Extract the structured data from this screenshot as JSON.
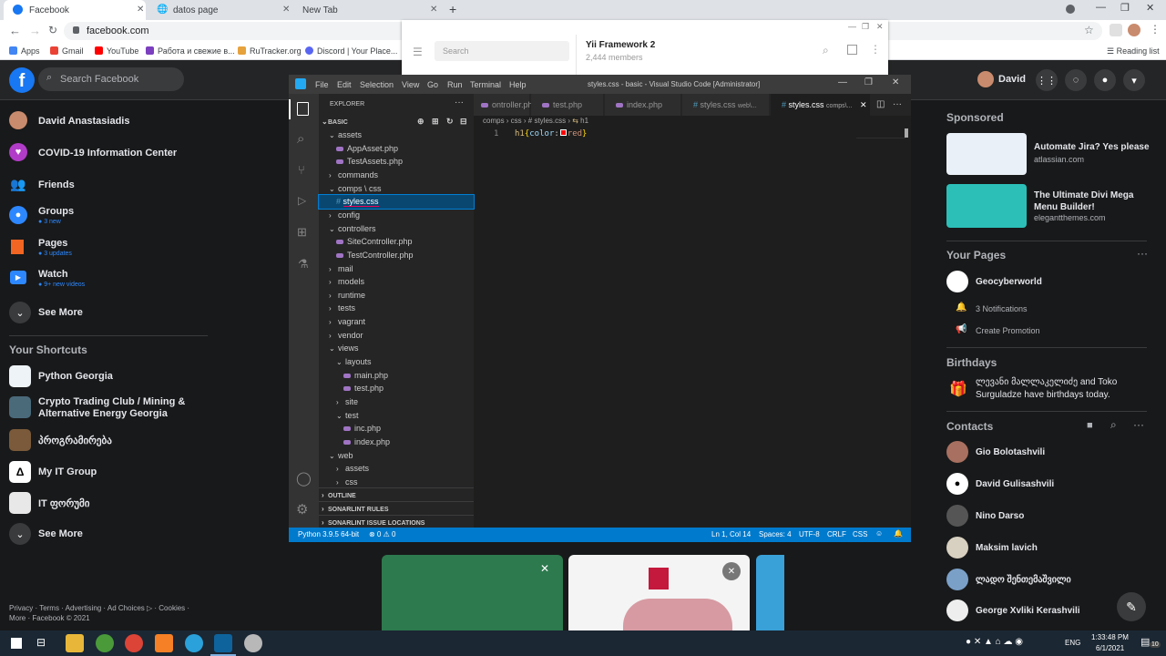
{
  "browser": {
    "tabs": [
      {
        "title": "Facebook",
        "active": true
      },
      {
        "title": "datos page",
        "active": false
      },
      {
        "title": "New Tab",
        "active": false
      }
    ],
    "url": "facebook.com",
    "bookmarks": [
      "Apps",
      "Gmail",
      "YouTube",
      "Работа и свежие в...",
      "RuTracker.org",
      "Discord | Your Place..."
    ],
    "reading_list": "Reading list"
  },
  "telegram": {
    "search_placeholder": "Search",
    "channel": "Yii Framework 2",
    "members": "2,444 members"
  },
  "facebook": {
    "search_placeholder": "Search Facebook",
    "user": "David",
    "sidebar": [
      {
        "label": "David Anastasiadis",
        "sub": ""
      },
      {
        "label": "COVID-19 Information Center",
        "sub": ""
      },
      {
        "label": "Friends",
        "sub": ""
      },
      {
        "label": "Groups",
        "sub": "3 new"
      },
      {
        "label": "Pages",
        "sub": "3 updates"
      },
      {
        "label": "Watch",
        "sub": "9+ new videos"
      },
      {
        "label": "See More",
        "sub": ""
      }
    ],
    "shortcuts_title": "Your Shortcuts",
    "shortcuts": [
      "Python Georgia",
      "Crypto Trading Club / Mining & Alternative Energy Georgia",
      "პროგრამირება",
      "My IT Group",
      "IT ფორუმი",
      "See More"
    ],
    "footer": [
      "Privacy · Terms · Advertising · Ad Choices ▷ · Cookies ·",
      "More · Facebook © 2021"
    ],
    "sponsored_title": "Sponsored",
    "ads": [
      {
        "title": "Automate Jira? Yes please",
        "domain": "atlassian.com"
      },
      {
        "title": "The Ultimate Divi Mega Menu Builder!",
        "domain": "elegantthemes.com"
      }
    ],
    "pages_title": "Your Pages",
    "page_name": "Geocyberworld",
    "notifications": "3 Notifications",
    "create_promotion": "Create Promotion",
    "birthdays_title": "Birthdays",
    "birthday_text_1": "ლევანი მალლაკელიძე and Toko",
    "birthday_text_2": "Surguladze have birthdays today.",
    "contacts_title": "Contacts",
    "contacts": [
      "Gio Bolotashvili",
      "David Gulisashvili",
      "Nino Darso",
      "Maksim lavich",
      "ლადო შენთემაშვილი",
      "George Xvliki Kerashvili"
    ]
  },
  "vscode": {
    "menu": [
      "File",
      "Edit",
      "Selection",
      "View",
      "Go",
      "Run",
      "Terminal",
      "Help"
    ],
    "title": "styles.css - basic - Visual Studio Code [Administrator]",
    "explorer_title": "EXPLORER",
    "root": "BASIC",
    "tree": [
      {
        "label": "assets",
        "type": "folder-open",
        "depth": 1
      },
      {
        "label": "AppAsset.php",
        "type": "php",
        "depth": 2
      },
      {
        "label": "TestAssets.php",
        "type": "php",
        "depth": 2
      },
      {
        "label": "commands",
        "type": "folder",
        "depth": 1
      },
      {
        "label": "comps \\ css",
        "type": "folder-open",
        "depth": 1
      },
      {
        "label": "styles.css",
        "type": "css",
        "depth": 2
      },
      {
        "label": "config",
        "type": "folder",
        "depth": 1
      },
      {
        "label": "controllers",
        "type": "folder-open",
        "depth": 1
      },
      {
        "label": "SiteController.php",
        "type": "php",
        "depth": 2
      },
      {
        "label": "TestController.php",
        "type": "php",
        "depth": 2
      },
      {
        "label": "mail",
        "type": "folder",
        "depth": 1
      },
      {
        "label": "models",
        "type": "folder",
        "depth": 1
      },
      {
        "label": "runtime",
        "type": "folder",
        "depth": 1
      },
      {
        "label": "tests",
        "type": "folder",
        "depth": 1
      },
      {
        "label": "vagrant",
        "type": "folder",
        "depth": 1
      },
      {
        "label": "vendor",
        "type": "folder",
        "depth": 1
      },
      {
        "label": "views",
        "type": "folder-open",
        "depth": 1
      },
      {
        "label": "layouts",
        "type": "folder-open",
        "depth": 2
      },
      {
        "label": "main.php",
        "type": "php",
        "depth": 3
      },
      {
        "label": "test.php",
        "type": "php",
        "depth": 3
      },
      {
        "label": "site",
        "type": "folder",
        "depth": 2
      },
      {
        "label": "test",
        "type": "folder-open",
        "depth": 2
      },
      {
        "label": "inc.php",
        "type": "php",
        "depth": 3
      },
      {
        "label": "index.php",
        "type": "php",
        "depth": 3
      },
      {
        "label": "web",
        "type": "folder-open",
        "depth": 1
      },
      {
        "label": "assets",
        "type": "folder",
        "depth": 2
      },
      {
        "label": "css",
        "type": "folder",
        "depth": 2
      }
    ],
    "panels": [
      "OUTLINE",
      "SONARLINT RULES",
      "SONARLINT ISSUE LOCATIONS"
    ],
    "tabs": [
      {
        "label": "ontroller.php",
        "desc": ""
      },
      {
        "label": "test.php",
        "desc": ""
      },
      {
        "label": "index.php",
        "desc": ""
      },
      {
        "label": "styles.css",
        "desc": "web\\..."
      },
      {
        "label": "styles.css",
        "desc": "comps\\..."
      }
    ],
    "breadcrumb": [
      "comps",
      "css",
      "# styles.css",
      "h1"
    ],
    "line_number": "1",
    "code": {
      "selector": "h1",
      "property": "color",
      "value": "red"
    },
    "status": {
      "python": "Python 3.9.5 64-bit",
      "problems": "⊗ 0 ⚠ 0",
      "position": "Ln 1, Col 14",
      "spaces": "Spaces: 4",
      "encoding": "UTF-8",
      "eol": "CRLF",
      "language": "CSS"
    }
  },
  "taskbar": {
    "language": "ENG",
    "time": "1:33:48 PM",
    "date": "6/1/2021",
    "notification_count": "10"
  }
}
